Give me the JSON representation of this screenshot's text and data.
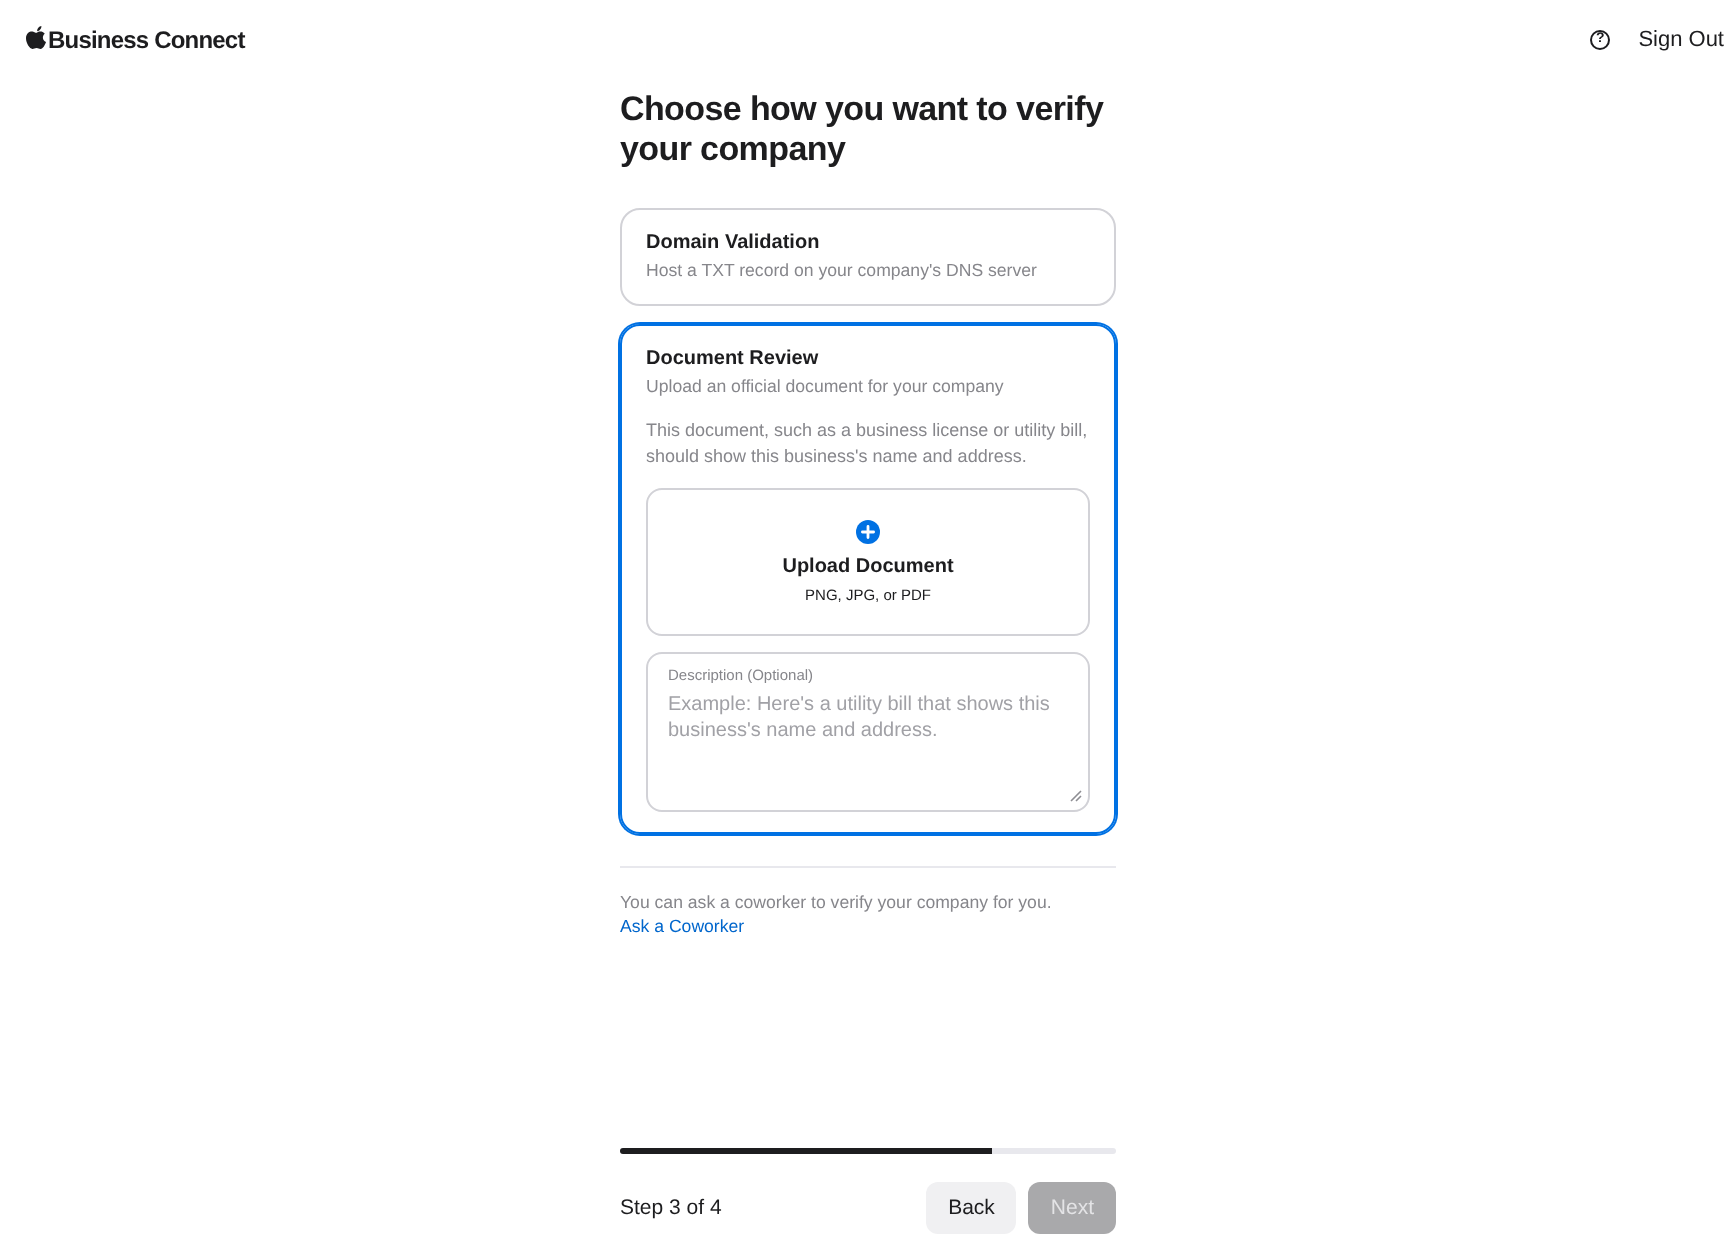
{
  "header": {
    "brand": "Business Connect",
    "help": "?",
    "sign_out": "Sign Out"
  },
  "title": "Choose how you want to verify your company",
  "options": [
    {
      "title": "Domain Validation",
      "subtitle": "Host a TXT record on your company's DNS server",
      "selected": false
    },
    {
      "title": "Document Review",
      "subtitle": "Upload an official document for your company",
      "selected": true,
      "details": {
        "note": "This document, such as a business license or utility bill, should show this business's name and address.",
        "upload": {
          "label": "Upload Document",
          "formats": "PNG, JPG, or PDF"
        },
        "description_field": {
          "label": "Description (Optional)",
          "placeholder": "Example: Here's a utility bill that shows this business's name and address."
        }
      }
    }
  ],
  "coworker": {
    "text": "You can ask a coworker to verify your company for you.",
    "link": "Ask a Coworker"
  },
  "progress": {
    "level": 0.75
  },
  "step": "Step 3 of 4",
  "buttons": [
    {
      "label": "Back",
      "kind": "secondary",
      "disabled": false
    },
    {
      "label": "Next",
      "kind": "primary",
      "disabled": true
    }
  ]
}
